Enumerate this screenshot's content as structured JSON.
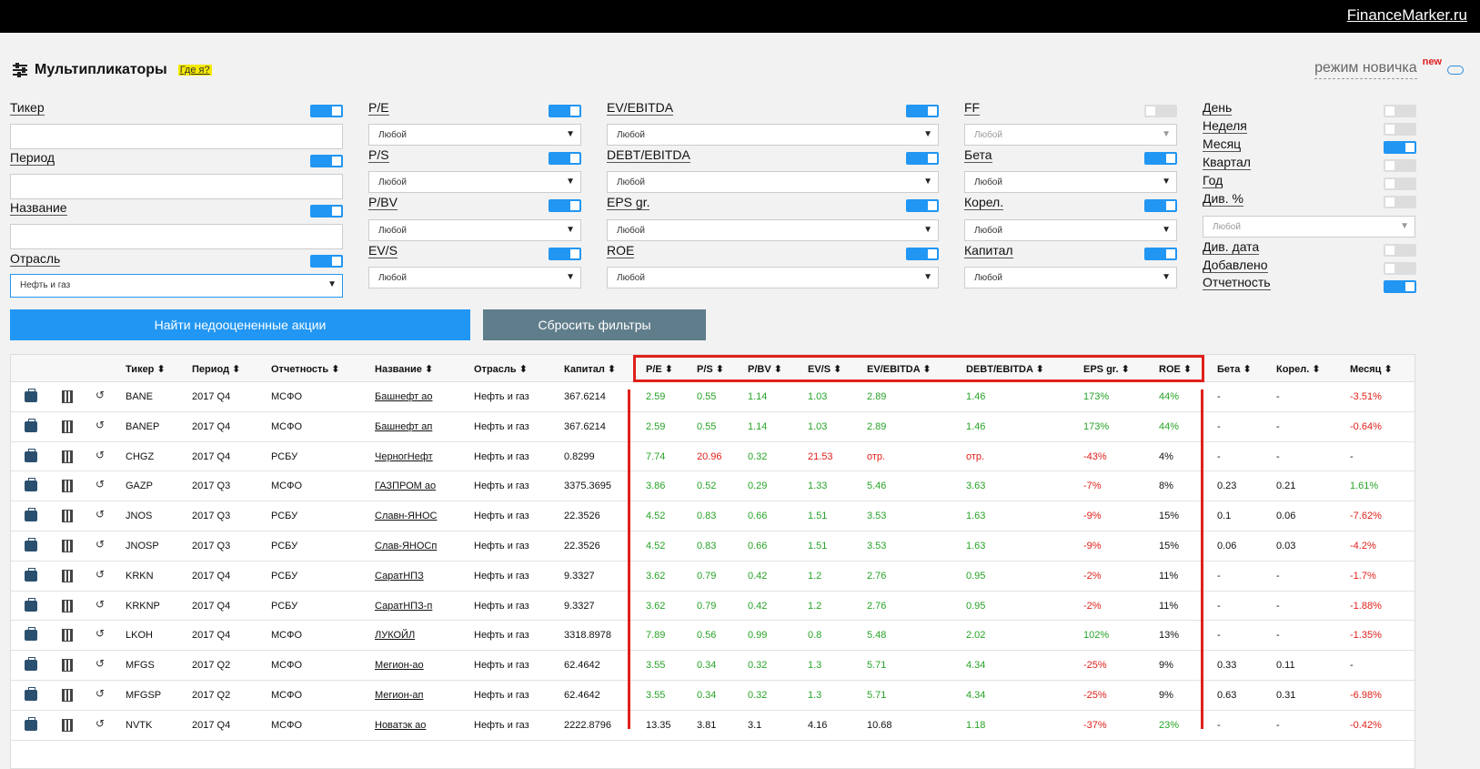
{
  "brand": "FinanceMarker.ru",
  "page": {
    "title": "Мультипликаторы",
    "where_link": "Где я?",
    "novice_mode": "режим новичка",
    "new_badge": "new"
  },
  "filters": {
    "col1": {
      "ticker": "Тикер",
      "period": "Период",
      "name": "Название",
      "sector": "Отрасль",
      "sector_value": "Нефть и газ"
    },
    "col2": {
      "pe": "P/E",
      "ps": "P/S",
      "pbv": "P/BV",
      "evs": "EV/S",
      "any": "Любой"
    },
    "col3": {
      "evebitda": "EV/EBITDA",
      "debtebitda": "DEBT/EBITDA",
      "epsgr": "EPS gr.",
      "roe": "ROE",
      "any": "Любой"
    },
    "col4": {
      "ff": "FF",
      "beta": "Бета",
      "corr": "Корел.",
      "capital": "Капитал",
      "any": "Любой"
    },
    "col5": {
      "day": "День",
      "week": "Неделя",
      "month": "Месяц",
      "quarter": "Квартал",
      "year": "Год",
      "div": "Див. %",
      "any": "Любой",
      "div_date": "Див. дата",
      "added": "Добавлено",
      "reporting": "Отчетность"
    },
    "find_button": "Найти недооцененные акции",
    "reset_button": "Сбросить фильтры"
  },
  "table": {
    "headers": {
      "ticker": "Тикер ⬍",
      "period": "Период ⬍",
      "report": "Отчетность ⬍",
      "name": "Название ⬍",
      "sector": "Отрасль ⬍",
      "capital": "Капитал ⬍",
      "pe": "P/E ⬍",
      "ps": "P/S ⬍",
      "pbv": "P/BV ⬍",
      "evs": "EV/S ⬍",
      "evebitda": "EV/EBITDA ⬍",
      "debtebitda": "DEBT/EBITDA ⬍",
      "epsgr": "EPS gr. ⬍",
      "roe": "ROE ⬍",
      "beta": "Бета ⬍",
      "corr": "Корел. ⬍",
      "month": "Месяц ⬍"
    },
    "rows": [
      {
        "ticker": "BANE",
        "period": "2017 Q4",
        "report": "МСФО",
        "name": "Башнефт ао",
        "sector": "Нефть и газ",
        "capital": "367.6214",
        "pe": "2.59",
        "ps": "0.55",
        "pbv": "1.14",
        "evs": "1.03",
        "evebitda": "2.89",
        "debtebitda": "1.46",
        "epsgr": "173%",
        "roe": "44%",
        "beta": "-",
        "corr": "-",
        "month": "-3.51%"
      },
      {
        "ticker": "BANEP",
        "period": "2017 Q4",
        "report": "МСФО",
        "name": "Башнефт ап",
        "sector": "Нефть и газ",
        "capital": "367.6214",
        "pe": "2.59",
        "ps": "0.55",
        "pbv": "1.14",
        "evs": "1.03",
        "evebitda": "2.89",
        "debtebitda": "1.46",
        "epsgr": "173%",
        "roe": "44%",
        "beta": "-",
        "corr": "-",
        "month": "-0.64%"
      },
      {
        "ticker": "CHGZ",
        "period": "2017 Q4",
        "report": "РСБУ",
        "name": "ЧерногНефт",
        "sector": "Нефть и газ",
        "capital": "0.8299",
        "pe": "7.74",
        "ps": "20.96",
        "pbv": "0.32",
        "evs": "21.53",
        "evebitda": "отр.",
        "debtebitda": "отр.",
        "epsgr": "-43%",
        "roe": "4%",
        "beta": "-",
        "corr": "-",
        "month": "-"
      },
      {
        "ticker": "GAZP",
        "period": "2017 Q3",
        "report": "МСФО",
        "name": "ГАЗПРОМ ао",
        "sector": "Нефть и газ",
        "capital": "3375.3695",
        "pe": "3.86",
        "ps": "0.52",
        "pbv": "0.29",
        "evs": "1.33",
        "evebitda": "5.46",
        "debtebitda": "3.63",
        "epsgr": "-7%",
        "roe": "8%",
        "beta": "0.23",
        "corr": "0.21",
        "month": "1.61%"
      },
      {
        "ticker": "JNOS",
        "period": "2017 Q3",
        "report": "РСБУ",
        "name": "Славн-ЯНОС",
        "sector": "Нефть и газ",
        "capital": "22.3526",
        "pe": "4.52",
        "ps": "0.83",
        "pbv": "0.66",
        "evs": "1.51",
        "evebitda": "3.53",
        "debtebitda": "1.63",
        "epsgr": "-9%",
        "roe": "15%",
        "beta": "0.1",
        "corr": "0.06",
        "month": "-7.62%"
      },
      {
        "ticker": "JNOSP",
        "period": "2017 Q3",
        "report": "РСБУ",
        "name": "Слав-ЯНОСп",
        "sector": "Нефть и газ",
        "capital": "22.3526",
        "pe": "4.52",
        "ps": "0.83",
        "pbv": "0.66",
        "evs": "1.51",
        "evebitda": "3.53",
        "debtebitda": "1.63",
        "epsgr": "-9%",
        "roe": "15%",
        "beta": "0.06",
        "corr": "0.03",
        "month": "-4.2%"
      },
      {
        "ticker": "KRKN",
        "period": "2017 Q4",
        "report": "РСБУ",
        "name": "СаратНПЗ",
        "sector": "Нефть и газ",
        "capital": "9.3327",
        "pe": "3.62",
        "ps": "0.79",
        "pbv": "0.42",
        "evs": "1.2",
        "evebitda": "2.76",
        "debtebitda": "0.95",
        "epsgr": "-2%",
        "roe": "11%",
        "beta": "-",
        "corr": "-",
        "month": "-1.7%"
      },
      {
        "ticker": "KRKNP",
        "period": "2017 Q4",
        "report": "РСБУ",
        "name": "СаратНПЗ-п",
        "sector": "Нефть и газ",
        "capital": "9.3327",
        "pe": "3.62",
        "ps": "0.79",
        "pbv": "0.42",
        "evs": "1.2",
        "evebitda": "2.76",
        "debtebitda": "0.95",
        "epsgr": "-2%",
        "roe": "11%",
        "beta": "-",
        "corr": "-",
        "month": "-1.88%"
      },
      {
        "ticker": "LKOH",
        "period": "2017 Q4",
        "report": "МСФО",
        "name": "ЛУКОЙЛ",
        "sector": "Нефть и газ",
        "capital": "3318.8978",
        "pe": "7.89",
        "ps": "0.56",
        "pbv": "0.99",
        "evs": "0.8",
        "evebitda": "5.48",
        "debtebitda": "2.02",
        "epsgr": "102%",
        "roe": "13%",
        "beta": "-",
        "corr": "-",
        "month": "-1.35%"
      },
      {
        "ticker": "MFGS",
        "period": "2017 Q2",
        "report": "МСФО",
        "name": "Мегион-ао",
        "sector": "Нефть и газ",
        "capital": "62.4642",
        "pe": "3.55",
        "ps": "0.34",
        "pbv": "0.32",
        "evs": "1.3",
        "evebitda": "5.71",
        "debtebitda": "4.34",
        "epsgr": "-25%",
        "roe": "9%",
        "beta": "0.33",
        "corr": "0.11",
        "month": "-"
      },
      {
        "ticker": "MFGSP",
        "period": "2017 Q2",
        "report": "МСФО",
        "name": "Мегион-ап",
        "sector": "Нефть и газ",
        "capital": "62.4642",
        "pe": "3.55",
        "ps": "0.34",
        "pbv": "0.32",
        "evs": "1.3",
        "evebitda": "5.71",
        "debtebitda": "4.34",
        "epsgr": "-25%",
        "roe": "9%",
        "beta": "0.63",
        "corr": "0.31",
        "month": "-6.98%"
      },
      {
        "ticker": "NVTK",
        "period": "2017 Q4",
        "report": "МСФО",
        "name": "Новатэк ао",
        "sector": "Нефть и газ",
        "capital": "2222.8796",
        "pe": "13.35",
        "ps": "3.81",
        "pbv": "3.1",
        "evs": "4.16",
        "evebitda": "10.68",
        "debtebitda": "1.18",
        "epsgr": "-37%",
        "roe": "23%",
        "beta": "-",
        "corr": "-",
        "month": "-0.42%"
      }
    ]
  },
  "colors": {
    "accent": "#2196f3",
    "positive": "#27a327",
    "negative": "#e0201b",
    "highlight": "#e0201b"
  }
}
